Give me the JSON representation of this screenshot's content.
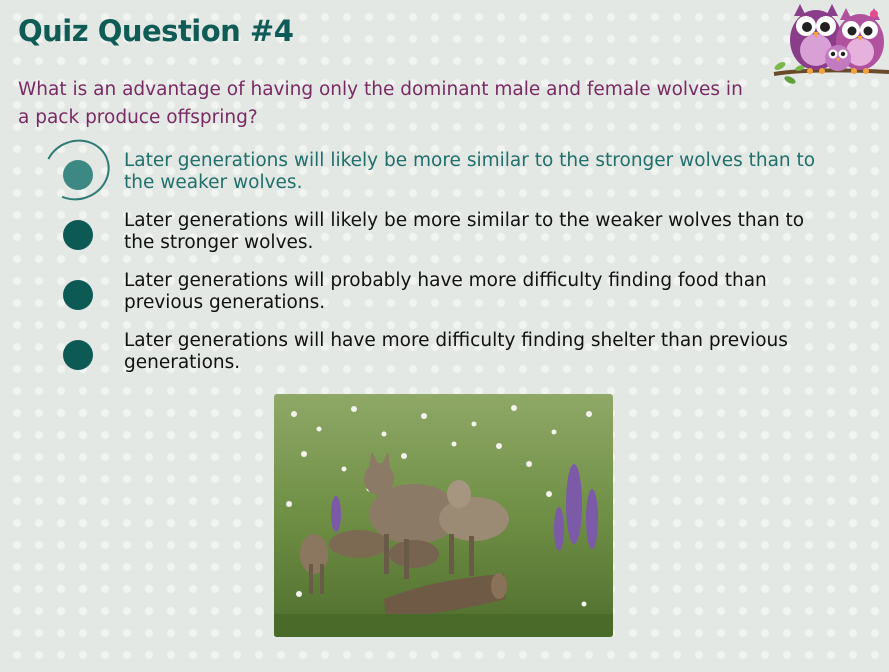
{
  "quiz": {
    "title": "Quiz Question #4",
    "question": "What is an advantage of having only the dominant male and female wolves in a pack produce offspring?",
    "options": [
      {
        "text": "Later generations will likely be more similar to the stronger wolves than to the weaker wolves.",
        "selected": true
      },
      {
        "text": "Later generations will likely be more similar to the weaker wolves than to the stronger wolves.",
        "selected": false
      },
      {
        "text": "Later generations will probably have more difficulty finding food than previous generations.",
        "selected": false
      },
      {
        "text": "Later generations will have more difficulty finding shelter than previous generations.",
        "selected": false
      }
    ]
  },
  "colors": {
    "title": "#0f5b56",
    "question": "#7a2a62",
    "radio": "#0d5a55",
    "radio_selected": "#3e8883",
    "selected_text": "#1f6f6a",
    "background": "#e4e8e5"
  },
  "images": {
    "owls": "owl-family-on-branch",
    "photo": "wolf-pack-in-flower-meadow"
  }
}
